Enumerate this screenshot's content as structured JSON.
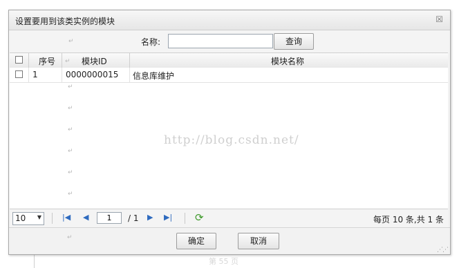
{
  "dialog": {
    "title": "设置要用到该类实例的模块",
    "close_symbol": "☒"
  },
  "search": {
    "label": "名称:",
    "value": "",
    "placeholder": "",
    "button_label": "查询"
  },
  "grid": {
    "columns": [
      "序号",
      "模块ID",
      "模块名称"
    ],
    "rows": [
      {
        "checked": false,
        "index": "1",
        "module_id": "0000000015",
        "module_name": "信息库维护"
      }
    ]
  },
  "pager": {
    "page_size": "10",
    "current_page": "1",
    "total_pages_text": "/ 1",
    "summary": "每页 10 条,共 1 条"
  },
  "footer": {
    "confirm_label": "确定",
    "cancel_label": "取消"
  },
  "watermark": "http://blog.csdn.net/",
  "background": {
    "bottom_text": "第 55 页"
  },
  "colors": {
    "nav_blue": "#2f6bbf",
    "refresh_green": "#3f9a2c"
  }
}
